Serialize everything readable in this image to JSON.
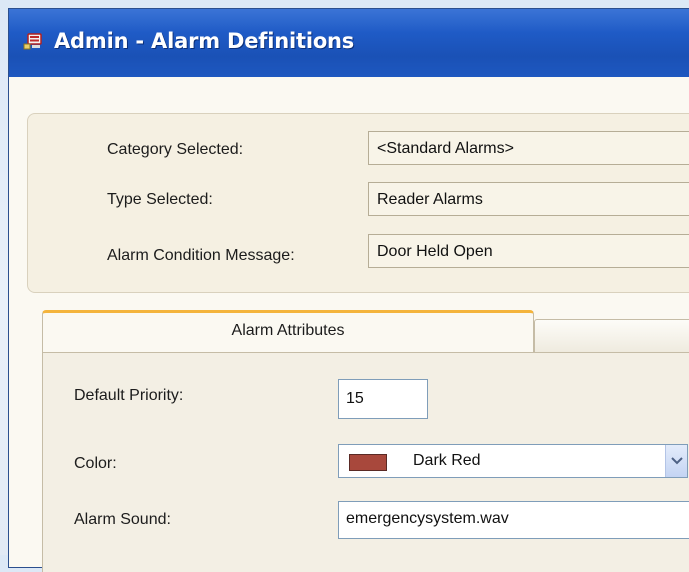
{
  "window": {
    "title": "Admin - Alarm Definitions",
    "icon": "admin-app-icon"
  },
  "header": {
    "category_label": "Category Selected:",
    "category_value": "<Standard Alarms>",
    "type_label": "Type Selected:",
    "type_value": "Reader Alarms",
    "message_label": "Alarm Condition Message:",
    "message_value": "Door Held Open"
  },
  "tabs": [
    {
      "label": "Alarm Attributes",
      "active": true
    },
    {
      "label": "",
      "active": false
    }
  ],
  "attributes": {
    "priority_label": "Default Priority:",
    "priority_value": "15",
    "color_label": "Color:",
    "color_value": "Dark Red",
    "color_swatch": "#a8483c",
    "sound_label": "Alarm Sound:",
    "sound_value": "emergencysystem.wav"
  },
  "colors": {
    "titlebar": "#1f5bc6",
    "tab_accent": "#f4b43c",
    "window_bg": "#fbf9f2"
  }
}
